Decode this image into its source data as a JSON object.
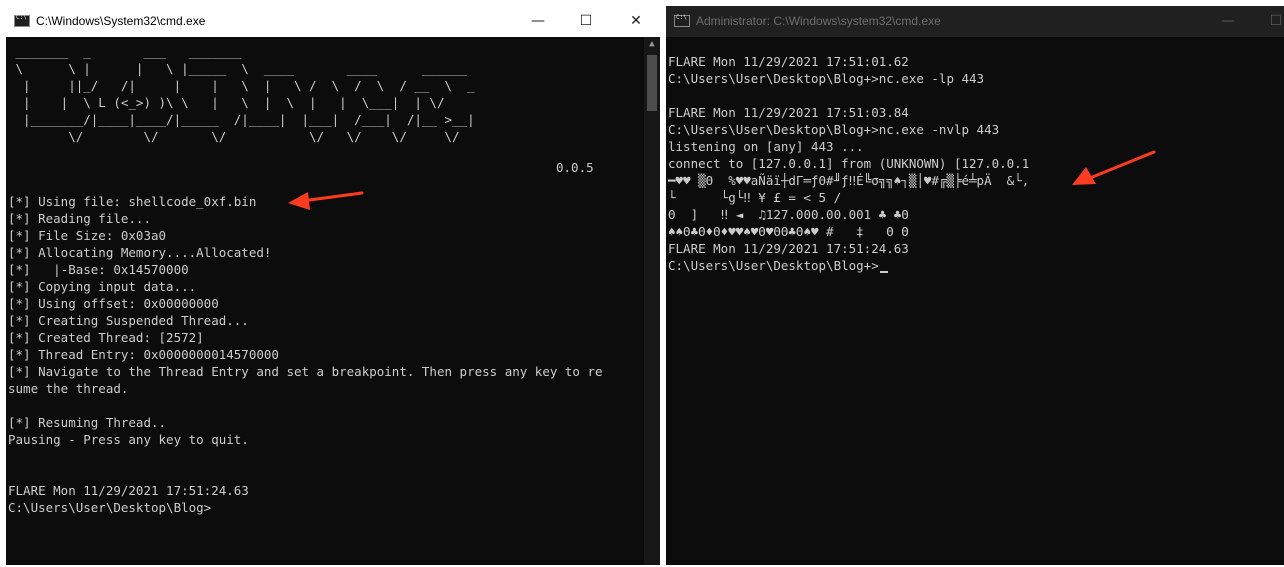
{
  "left_window": {
    "title": "C:\\Windows\\System32\\cmd.exe",
    "controls": {
      "minimize": "—",
      "maximize": "☐",
      "close": "✕"
    },
    "banner": [
      " _______  _       ___   _______",
      " \\      \\ |      |   \\ |_____  \\  ____       ____      ______",
      "  |     ||_/   /|     |    |   \\  |   \\ /  \\  /  \\  / __  \\  _ ",
      "  |    |  \\ L (<_>) )\\ \\   |   \\  |  \\  |   |  \\___|  | \\/ ",
      "  |_______/|____|____/|_____  /|____|  |___|  /___|  /|__ >__|",
      "        \\/        \\/       \\/           \\/   \\/    \\/     \\/"
    ],
    "version": "0.0.5",
    "lines": [
      "",
      "[*] Using file: shellcode_0xf.bin",
      "[*] Reading file...",
      "[*] File Size: 0x03a0",
      "[*] Allocating Memory....Allocated!",
      "[*]   |-Base: 0x14570000",
      "[*] Copying input data...",
      "[*] Using offset: 0x00000000",
      "[*] Creating Suspended Thread...",
      "[*] Created Thread: [2572]",
      "[*] Thread Entry: 0x0000000014570000",
      "[*] Navigate to the Thread Entry and set a breakpoint. Then press any key to re",
      "sume the thread.",
      "",
      "[*] Resuming Thread..",
      "Pausing - Press any key to quit.",
      "",
      "",
      "FLARE Mon 11/29/2021 17:51:24.63",
      "C:\\Users\\User\\Desktop\\Blog>"
    ]
  },
  "right_window": {
    "title": "Administrator: C:\\Windows\\system32\\cmd.exe",
    "controls": {
      "minimize": "—",
      "maximize": "☐"
    },
    "lines": [
      "FLARE Mon 11/29/2021 17:51:01.62",
      "C:\\Users\\User\\Desktop\\Blog+>nc.exe -lp 443",
      "",
      "FLARE Mon 11/29/2021 17:51:03.84",
      "C:\\Users\\User\\Desktop\\Blog+>nc.exe -nvlp 443",
      "listening on [any] 443 ...",
      "connect to [127.0.0.1] from (UNKNOWN) [127.0.0.1",
      "━♥♥ ▒Θ  %♥♥aÑäï┼dΓ═ƒΘ#╜ƒ‼É╚σ╗╗♠┐▒│♥#╔▒╞é╧pÄ  &└,",
      "└      └g└‼ ¥ £ = < 5 /",
      "Θ  ]   ‼ ◄  ♫127.000.00.001 ♣ ♣Θ",
      "♠♠Θ♣Θ♦Θ♦♥♥♠♥Θ♥ΘΘ♣Θ♠♥ #   ‡   Θ Θ",
      "FLARE Mon 11/29/2021 17:51:24.63",
      "C:\\Users\\User\\Desktop\\Blog+>"
    ]
  },
  "annotations": {
    "arrow_color": "#ff3b1f"
  }
}
